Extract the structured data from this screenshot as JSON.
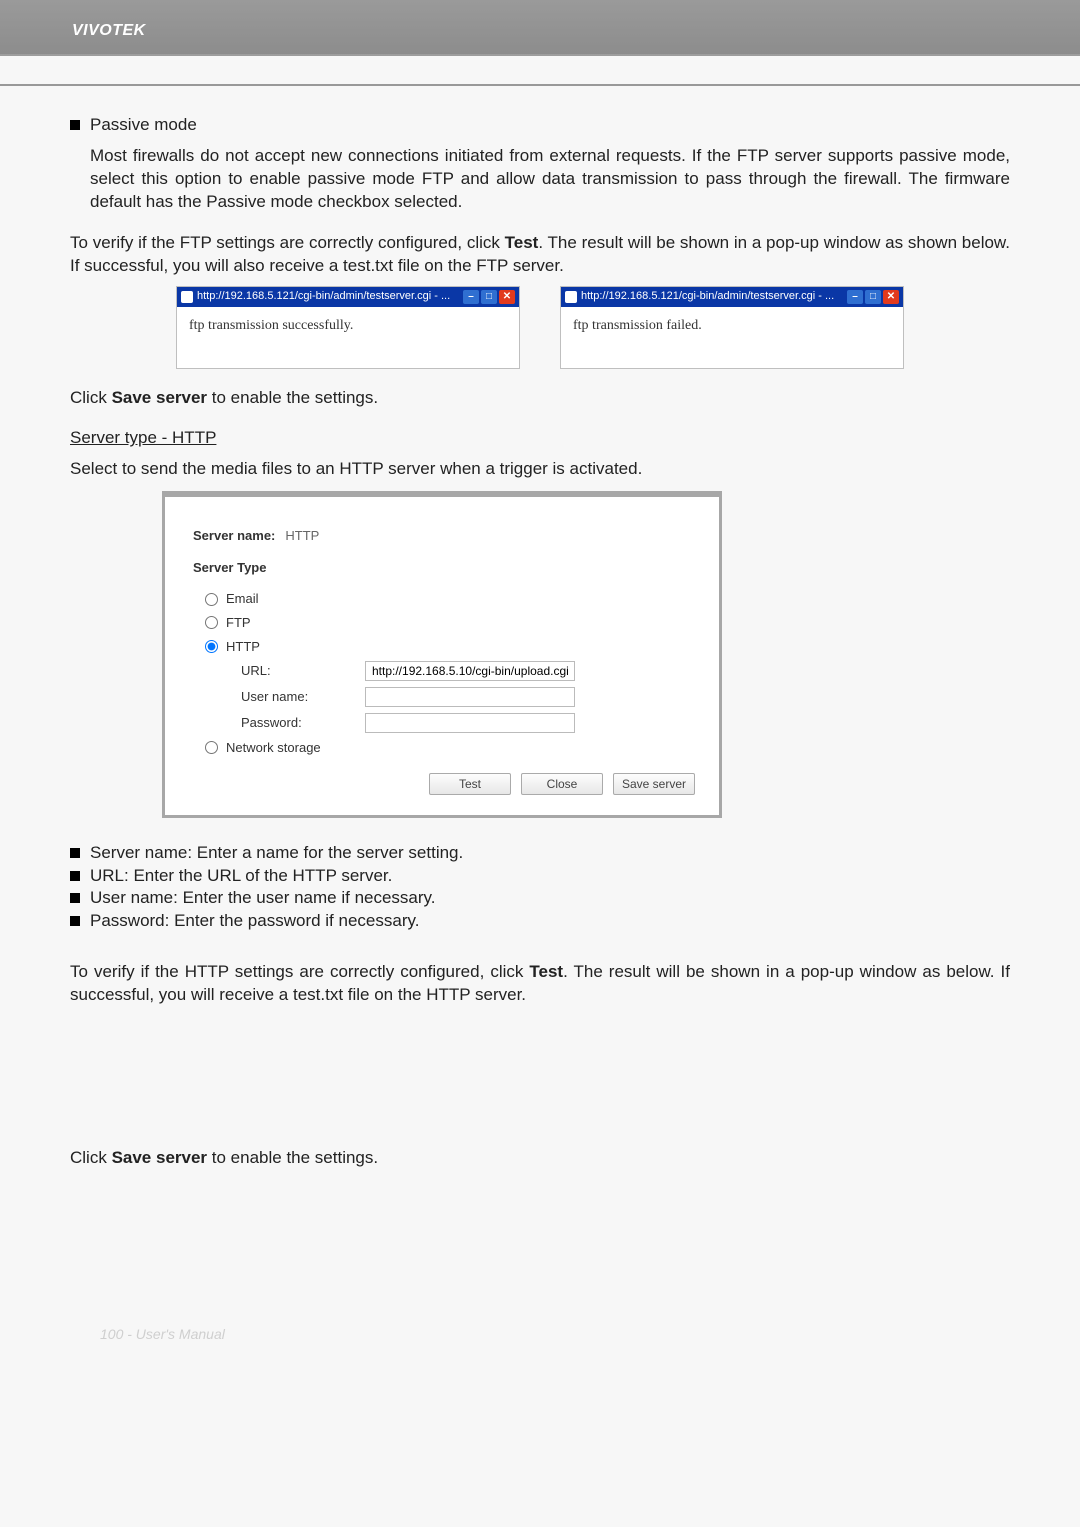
{
  "header": {
    "brand": "VIVOTEK"
  },
  "passive": {
    "title": "Passive mode",
    "body": "Most firewalls do not accept new connections initiated from external requests. If the FTP server supports passive mode, select this option to enable passive mode FTP and allow data transmission to pass through the firewall. The firmware default has the Passive mode checkbox selected."
  },
  "verify_ftp_pre": "To verify if the FTP settings are correctly configured, click ",
  "verify_ftp_bold": "Test",
  "verify_ftp_post": ". The result will be shown in a pop-up window as shown below. If successful, you will also receive a test.txt file on the FTP server.",
  "popup": {
    "title": "http://192.168.5.121/cgi-bin/admin/testserver.cgi - ...",
    "success": "ftp transmission successfully.",
    "failed": "ftp transmission failed."
  },
  "save_pre": "Click ",
  "save_bold": "Save server",
  "save_post": " to enable the settings.",
  "http_section": {
    "heading": "Server type - HTTP",
    "desc": "Select to send the media files to an HTTP server when a trigger is activated."
  },
  "panel": {
    "server_name_label": "Server name:",
    "server_name_value": "HTTP",
    "server_type_heading": "Server Type",
    "opt_email": "Email",
    "opt_ftp": "FTP",
    "opt_http": "HTTP",
    "opt_netstore": "Network storage",
    "url_label": "URL:",
    "url_value": "http://192.168.5.10/cgi-bin/upload.cgi",
    "user_label": "User name:",
    "pass_label": "Password:",
    "btn_test": "Test",
    "btn_close": "Close",
    "btn_save": "Save server"
  },
  "bullets": {
    "server_name": "Server name: Enter a name for the server setting.",
    "url": "URL: Enter the URL of the HTTP server.",
    "user": "User name: Enter the user name if necessary.",
    "pass": "Password: Enter the password if necessary."
  },
  "verify_http_pre": "To verify if the HTTP settings are correctly configured, click ",
  "verify_http_bold": "Test",
  "verify_http_post": ". The result will be shown in a pop-up window as below. If successful, you will receive a test.txt file on the HTTP server.",
  "footer": "100 - User's Manual"
}
